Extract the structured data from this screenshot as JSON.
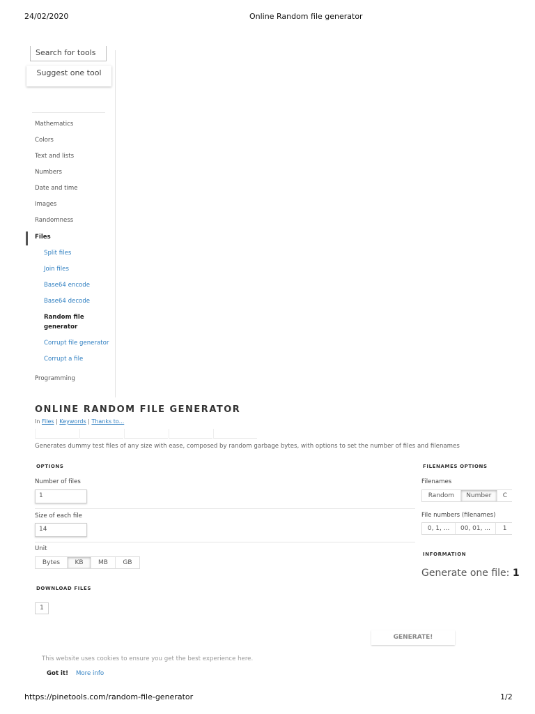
{
  "print_header": {
    "date": "24/02/2020",
    "doc_title": "Online Random file generator"
  },
  "print_footer": {
    "url": "https://pinetools.com/random-file-generator",
    "page": "1/2"
  },
  "sidebar": {
    "search_placeholder": "Search for tools",
    "suggest_label": "Suggest one tool",
    "categories": [
      "Mathematics",
      "Colors",
      "Text and lists",
      "Numbers",
      "Date and time",
      "Images",
      "Randomness",
      "Files",
      "Programming"
    ],
    "active_category": "Files",
    "file_tools": [
      "Split files",
      "Join files",
      "Base64 encode",
      "Base64 decode",
      "Random file generator",
      "Corrupt file generator",
      "Corrupt a file"
    ],
    "current_tool": "Random file generator"
  },
  "main": {
    "title": "ONLINE RANDOM FILE GENERATOR",
    "breadcrumb": {
      "prefix": "In",
      "links": [
        "Files",
        "Keywords",
        "Thanks to..."
      ]
    },
    "description": "Generates dummy test files of any size with ease, composed by random garbage bytes, with options to set the number of files and filenames"
  },
  "options": {
    "heading": "OPTIONS",
    "number_of_files": {
      "label": "Number of files",
      "value": "1"
    },
    "size_of_each_file": {
      "label": "Size of each file",
      "value": "14"
    },
    "unit": {
      "label": "Unit",
      "options": [
        "Bytes",
        "KB",
        "MB",
        "GB"
      ],
      "selected": "KB"
    }
  },
  "filenames_options": {
    "heading": "FILENAMES OPTIONS",
    "filenames": {
      "label": "Filenames",
      "options": [
        "Random",
        "Number",
        "C"
      ],
      "selected": "Number"
    },
    "file_numbers": {
      "label": "File numbers (filenames)",
      "options": [
        "0, 1, ...",
        "00, 01, ...",
        "1"
      ]
    }
  },
  "information": {
    "heading": "INFORMATION",
    "text": "Generate one file:",
    "value": "1"
  },
  "download": {
    "heading": "DOWNLOAD FILES",
    "file_button": "1"
  },
  "generate_label": "GENERATE!",
  "cookie": {
    "text": "This website uses cookies to ensure you get the best experience here.",
    "accept": "Got it!",
    "more": "More info"
  }
}
